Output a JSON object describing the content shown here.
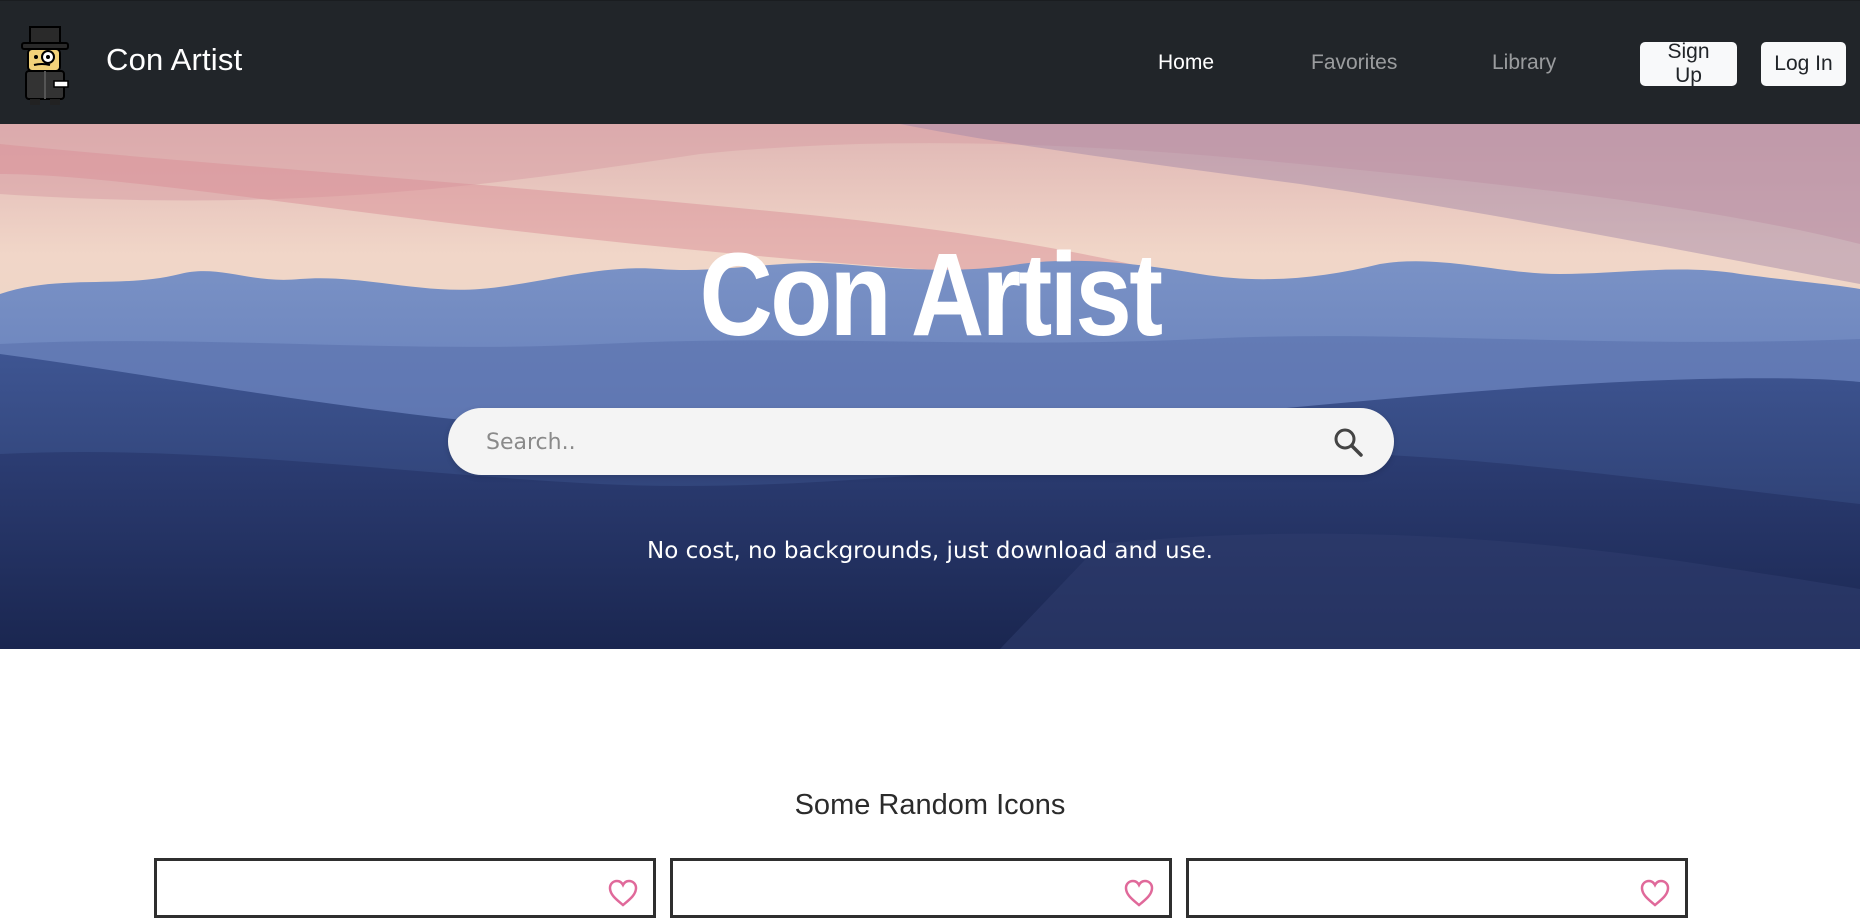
{
  "brand": {
    "name": "Con Artist",
    "logo_icon": "gentleman-top-hat-monocle-icon"
  },
  "nav": {
    "links": [
      {
        "label": "Home",
        "active": true
      },
      {
        "label": "Favorites",
        "active": false
      },
      {
        "label": "Library",
        "active": false
      }
    ],
    "signup_label": "Sign Up",
    "login_label": "Log In"
  },
  "hero": {
    "title": "Con Artist",
    "search_placeholder": "Search..",
    "search_icon": "search-icon",
    "tagline": "No cost, no backgrounds, just download and use."
  },
  "random_icons": {
    "title": "Some Random Icons",
    "cards": [
      {
        "favorite_icon": "heart-outline-icon"
      },
      {
        "favorite_icon": "heart-outline-icon"
      },
      {
        "favorite_icon": "heart-outline-icon"
      }
    ]
  },
  "colors": {
    "navbar_bg": "#212529",
    "heart_pink": "#e0699a",
    "button_bg": "#f8f9fa"
  }
}
